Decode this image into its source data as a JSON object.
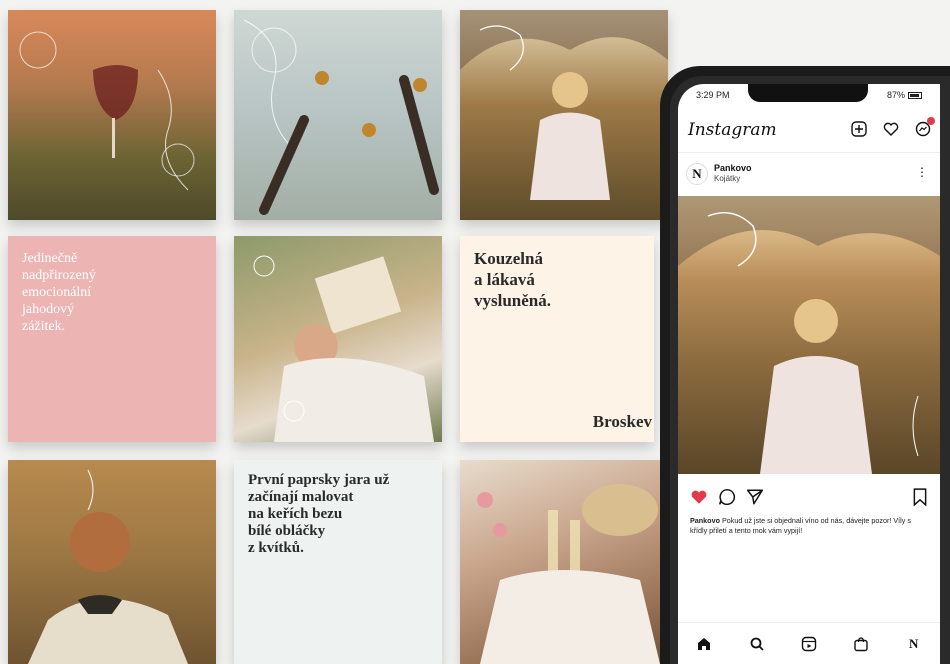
{
  "tiles": {
    "pink_text": [
      "Jedinečně",
      "nadpřirozený",
      "emocionální",
      "jahodový",
      "zážitek."
    ],
    "cream_text": [
      "Kouzelná",
      "a lákavá",
      "vysluněná."
    ],
    "cream_brand": "Broskev",
    "blue_text": [
      "První paprsky jara už",
      "začínají malovat",
      "na keřích bezu",
      "bílé obláčky",
      "z kvítků."
    ]
  },
  "phone": {
    "status_time": "3:29 PM",
    "status_battery": "87%",
    "app_logo": "Instagram",
    "profile_name": "Pankovo",
    "profile_location": "Kojátky",
    "avatar_letter": "N",
    "caption_user": "Pankovo",
    "caption_text": "Pokud už jste si objednali víno od nás, dávejte pozor! Víly s křídly přiletí a tento mok vám vypijí!",
    "nav_profile_letter": "N",
    "colors": {
      "like": "#e23a4a",
      "notification": "#e23a4a"
    }
  }
}
